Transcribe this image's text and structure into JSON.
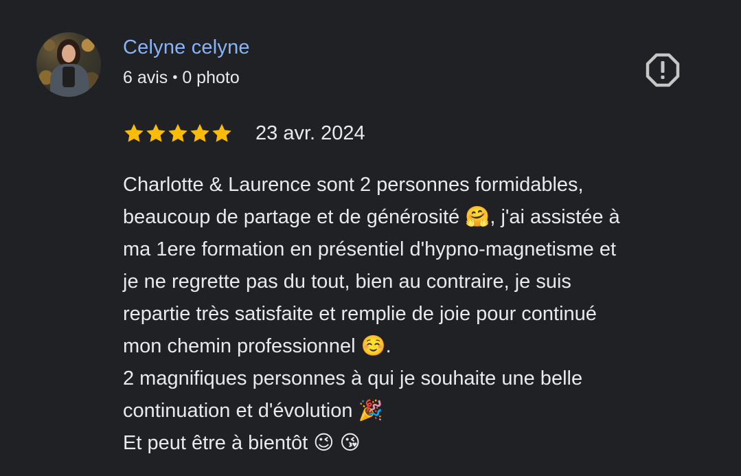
{
  "review": {
    "author_name": "Celyne celyne",
    "reviews_count": "6 avis",
    "meta_separator": "•",
    "photos_count": "0 photo",
    "rating": 5,
    "rating_max": 5,
    "star_color": "#fbbc04",
    "date": "23 avr. 2024",
    "text_lines": [
      "Charlotte & Laurence sont 2 personnes formidables,",
      "beaucoup de partage et de générosité 🤗, j'ai assistée à",
      "ma 1ere formation en présentiel d'hypno-magnetisme et",
      "je ne regrette pas du tout, bien au contraire, je suis",
      "repartie très satisfaite et remplie de joie pour continué",
      "mon chemin professionnel ☺️.",
      "2 magnifiques personnes à qui je souhaite une belle",
      "continuation et d'évolution 🎉",
      "Et peut être à bientôt 😉 😘"
    ]
  },
  "icons": {
    "avatar": "avatar-photo",
    "report": "report-flag-icon",
    "star": "star-icon"
  },
  "colors": {
    "background": "#202124",
    "author_link": "#8ab4f8",
    "text": "#e8eaed",
    "icon": "#c4c7c5"
  }
}
